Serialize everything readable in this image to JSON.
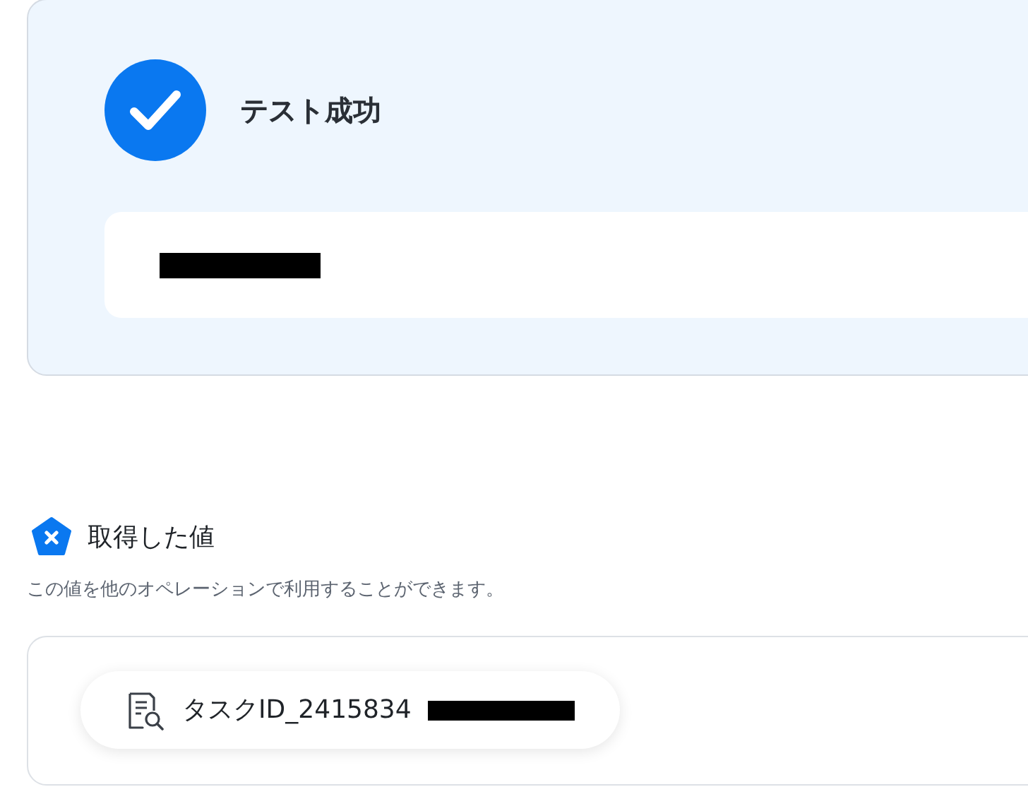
{
  "status": {
    "title": "テスト成功"
  },
  "section": {
    "title": "取得した値",
    "description": "この値を他のオペレーションで利用することができます。"
  },
  "values": [
    {
      "label": "タスクID_2415834"
    }
  ]
}
